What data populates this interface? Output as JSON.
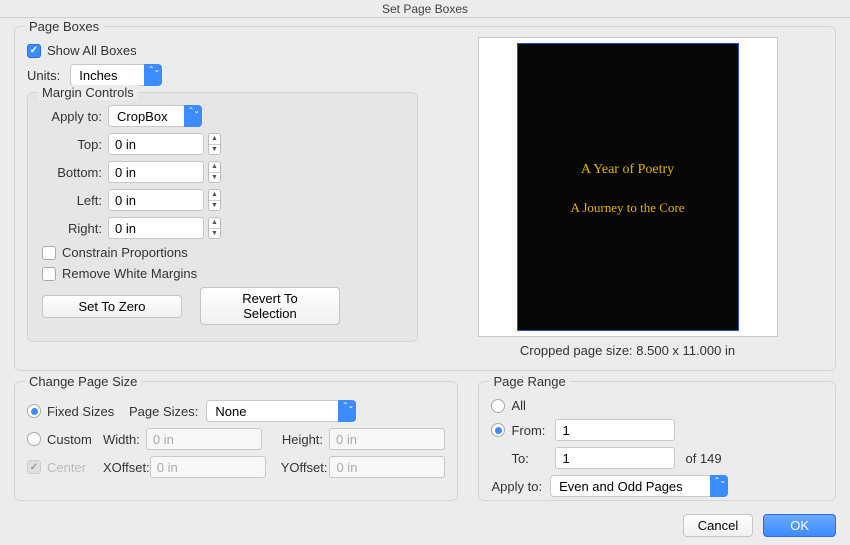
{
  "title": "Set Page Boxes",
  "pageBoxes": {
    "legend": "Page Boxes",
    "showAllBoxes": {
      "label": "Show All Boxes",
      "checked": true
    },
    "units": {
      "label": "Units:",
      "value": "Inches"
    },
    "marginControls": {
      "legend": "Margin Controls",
      "applyTo": {
        "label": "Apply to:",
        "value": "CropBox"
      },
      "top": {
        "label": "Top:",
        "value": "0 in"
      },
      "bottom": {
        "label": "Bottom:",
        "value": "0 in"
      },
      "left": {
        "label": "Left:",
        "value": "0 in"
      },
      "right": {
        "label": "Right:",
        "value": "0 in"
      },
      "constrain": {
        "label": "Constrain Proportions",
        "checked": false
      },
      "removeWhite": {
        "label": "Remove White Margins",
        "checked": false
      },
      "setToZero": "Set To Zero",
      "revert": "Revert To Selection"
    },
    "preview": {
      "line1": "A Year of Poetry",
      "line2": "A Journey to the Core",
      "caption": "Cropped page size: 8.500 x 11.000 in"
    }
  },
  "changePageSize": {
    "legend": "Change Page Size",
    "fixed": {
      "label": "Fixed Sizes",
      "checked": true
    },
    "pageSizes": {
      "label": "Page Sizes:",
      "value": "None"
    },
    "custom": {
      "label": "Custom",
      "checked": false
    },
    "width": {
      "label": "Width:",
      "value": "0 in"
    },
    "height": {
      "label": "Height:",
      "value": "0 in"
    },
    "center": {
      "label": "Center",
      "checked": true
    },
    "xoffset": {
      "label": "XOffset:",
      "value": "0 in"
    },
    "yoffset": {
      "label": "YOffset:",
      "value": "0 in"
    }
  },
  "pageRange": {
    "legend": "Page Range",
    "all": {
      "label": "All",
      "checked": false
    },
    "from": {
      "label": "From:",
      "value": "1",
      "checked": true
    },
    "to": {
      "label": "To:",
      "value": "1"
    },
    "ofTotal": "of 149",
    "applyTo": {
      "label": "Apply to:",
      "value": "Even and Odd Pages"
    }
  },
  "buttons": {
    "cancel": "Cancel",
    "ok": "OK"
  }
}
